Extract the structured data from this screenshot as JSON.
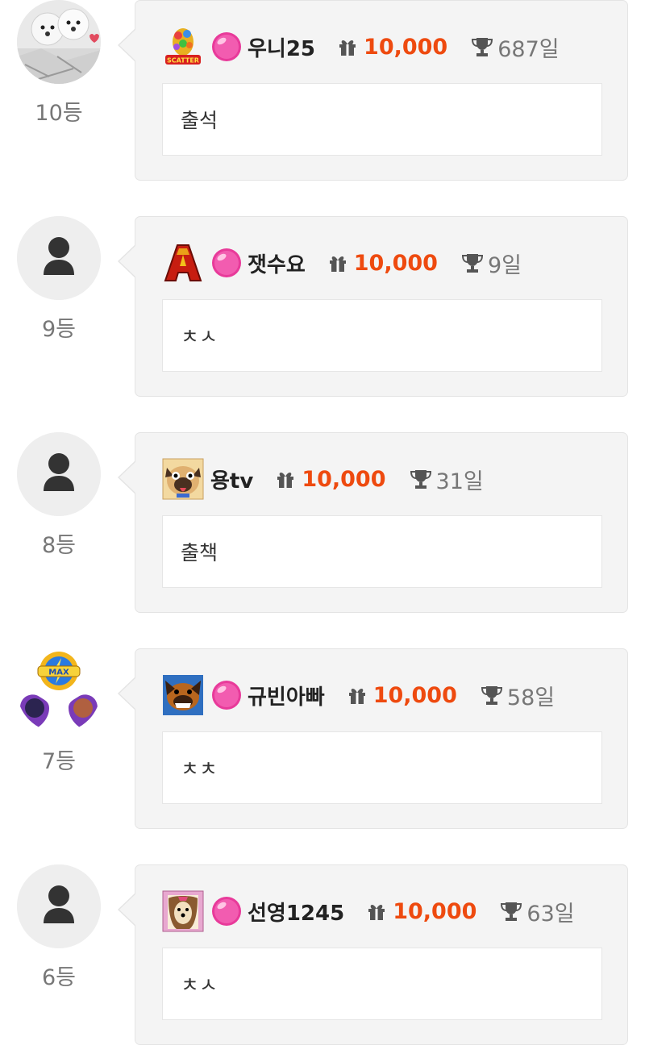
{
  "entries": [
    {
      "rank": "10등",
      "nickname": "우니25",
      "amount": "10,000",
      "days": "687일",
      "message": "출석",
      "badge": "scatter-badge",
      "avatar": "puppies-photo",
      "has_candy": true
    },
    {
      "rank": "9등",
      "nickname": "잿수요",
      "amount": "10,000",
      "days": "9일",
      "message": "ㅊㅅ",
      "badge": "letter-a-badge",
      "avatar": "default-user",
      "has_candy": true
    },
    {
      "rank": "8등",
      "nickname": "용tv",
      "amount": "10,000",
      "days": "31일",
      "message": "출책",
      "badge": "pug-badge",
      "avatar": "default-user",
      "has_candy": false
    },
    {
      "rank": "7등",
      "nickname": "규빈아빠",
      "amount": "10,000",
      "days": "58일",
      "message": "ㅊㅊ",
      "badge": "dog-badge",
      "avatar": "max-badges",
      "has_candy": true
    },
    {
      "rank": "6등",
      "nickname": "선영1245",
      "amount": "10,000",
      "days": "63일",
      "message": "ㅊㅅ",
      "badge": "shih-tzu-badge",
      "avatar": "default-user",
      "has_candy": true
    }
  ],
  "icons": {
    "gift": "gift-icon",
    "trophy": "trophy-icon",
    "candy": "pink-candy-icon"
  },
  "colors": {
    "amount": "#ee4a0f",
    "card_bg": "#f4f4f4",
    "rank_text": "#777777"
  }
}
